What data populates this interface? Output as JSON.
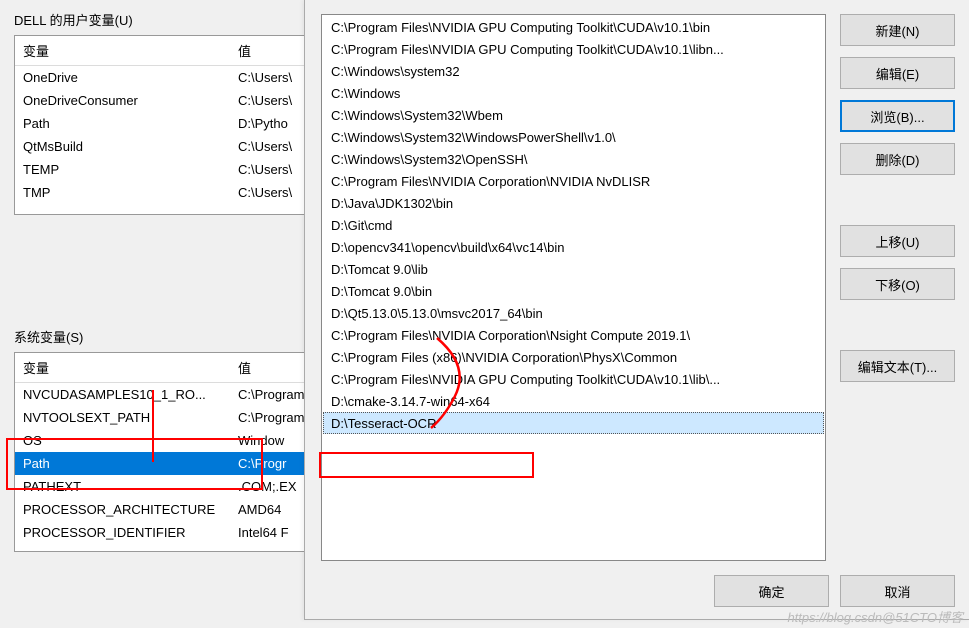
{
  "userSection": {
    "title": "DELL 的用户变量(U)",
    "headers": {
      "var": "变量",
      "val": "值"
    },
    "rows": [
      {
        "var": "OneDrive",
        "val": "C:\\Users\\"
      },
      {
        "var": "OneDriveConsumer",
        "val": "C:\\Users\\"
      },
      {
        "var": "Path",
        "val": "D:\\Pytho"
      },
      {
        "var": "QtMsBuild",
        "val": "C:\\Users\\"
      },
      {
        "var": "TEMP",
        "val": "C:\\Users\\"
      },
      {
        "var": "TMP",
        "val": "C:\\Users\\"
      }
    ]
  },
  "sysSection": {
    "title": "系统变量(S)",
    "headers": {
      "var": "变量",
      "val": "值"
    },
    "rows": [
      {
        "var": "NVCUDASAMPLES10_1_RO...",
        "val": "C:\\Program"
      },
      {
        "var": "NVTOOLSEXT_PATH",
        "val": "C:\\Program"
      },
      {
        "var": "OS",
        "val": "Window"
      },
      {
        "var": "Path",
        "val": "C:\\Progr",
        "selected": true
      },
      {
        "var": "PATHEXT",
        "val": ".COM;.EX"
      },
      {
        "var": "PROCESSOR_ARCHITECTURE",
        "val": "AMD64"
      },
      {
        "var": "PROCESSOR_IDENTIFIER",
        "val": "Intel64 F"
      }
    ]
  },
  "pathList": [
    "C:\\Program Files\\NVIDIA GPU Computing Toolkit\\CUDA\\v10.1\\bin",
    "C:\\Program Files\\NVIDIA GPU Computing Toolkit\\CUDA\\v10.1\\libn...",
    "C:\\Windows\\system32",
    "C:\\Windows",
    "C:\\Windows\\System32\\Wbem",
    "C:\\Windows\\System32\\WindowsPowerShell\\v1.0\\",
    "C:\\Windows\\System32\\OpenSSH\\",
    "C:\\Program Files\\NVIDIA Corporation\\NVIDIA NvDLISR",
    "D:\\Java\\JDK1302\\bin",
    "D:\\Git\\cmd",
    "D:\\opencv341\\opencv\\build\\x64\\vc14\\bin",
    "D:\\Tomcat 9.0\\lib",
    "D:\\Tomcat 9.0\\bin",
    "D:\\Qt5.13.0\\5.13.0\\msvc2017_64\\bin",
    "C:\\Program Files\\NVIDIA Corporation\\Nsight Compute 2019.1\\",
    "C:\\Program Files (x86)\\NVIDIA Corporation\\PhysX\\Common",
    "C:\\Program Files\\NVIDIA GPU Computing Toolkit\\CUDA\\v10.1\\lib\\...",
    "D:\\cmake-3.14.7-win64-x64",
    "D:\\Tesseract-OCR"
  ],
  "selectedPathIndex": 18,
  "buttons": {
    "new": "新建(N)",
    "edit": "编辑(E)",
    "browse": "浏览(B)...",
    "delete": "删除(D)",
    "moveUp": "上移(U)",
    "moveDown": "下移(O)",
    "editText": "编辑文本(T)...",
    "ok": "确定",
    "cancel": "取消"
  },
  "watermark": "https://blog.csdn@51CTO博客"
}
